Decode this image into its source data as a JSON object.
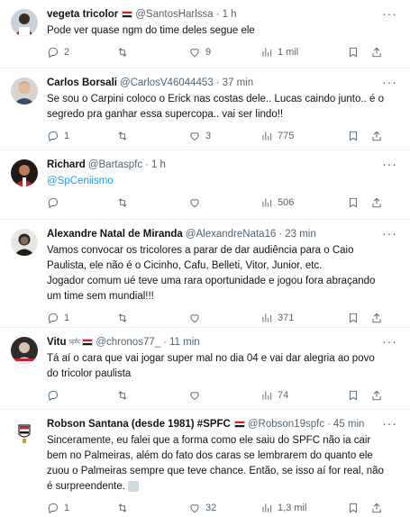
{
  "tweets": [
    {
      "name": "vegeta tricolor",
      "handle": "@SantosHarlssa",
      "time": "1 h",
      "text": "Pode ver quase ngm do time deles segue ele",
      "replies": "2",
      "retweets": "",
      "likes": "9",
      "views": "1 mil"
    },
    {
      "name": "Carlos Borsali",
      "handle": "@CarlosV46044453",
      "time": "37 min",
      "text": "Se sou o Carpini coloco o Erick nas costas dele..  Lucas caindo junto..  é o segredo pra ganhar essa supercopa.. vai ser lindo!!",
      "replies": "1",
      "retweets": "",
      "likes": "3",
      "views": "775"
    },
    {
      "name": "Richard",
      "handle": "@Bartaspfc",
      "time": "1 h",
      "text": "@SpCeniismo",
      "replies": "",
      "retweets": "",
      "likes": "",
      "views": "506"
    },
    {
      "name": "Alexandre Natal de Miranda",
      "handle": "@AlexandreNata16",
      "time": "23 min",
      "text": "Vamos convocar os tricolores a parar de dar audiência para o Caio Paulista,  ele não é o Cicinho,  Cafu, Belleti, Vitor, Junior, etc.\nJogador comum ué teve uma rara oportunidade e jogou fora abraçando um time sem mundial!!!",
      "replies": "1",
      "retweets": "",
      "likes": "",
      "views": "371"
    },
    {
      "name": "Vitu",
      "name_sup": "spfc",
      "handle": "@chronos77_",
      "time": "11 min",
      "text": "Tá aí o cara que vai jogar super mal no dia 04 e vai dar alegria ao povo do tricolor paulista",
      "replies": "",
      "retweets": "",
      "likes": "",
      "views": "74"
    },
    {
      "name": "Robson Santana (desde 1981) #SPFC",
      "handle": "@Robson19spfc",
      "time": "45 min",
      "text": "Sinceramente, eu falei que a forma como ele saiu do SPFC não ia cair bem no Palmeiras, além do fato dos caras se lembrarem do quanto ele zuou o Palmeiras sempre que teve chance. Então, se isso aí for real, não é surpreendente.",
      "replies": "1",
      "retweets": "",
      "likes": "32",
      "views": "1,3 mil"
    }
  ],
  "icons": {
    "reply": "reply-icon",
    "retweet": "retweet-icon",
    "like": "heart-icon",
    "views": "views-icon",
    "bookmark": "bookmark-icon",
    "share": "share-icon",
    "more": "more-icon"
  },
  "colors": {
    "text": "#0f1419",
    "secondary": "#536471",
    "link": "#1d9bf0",
    "divider": "#eff3f4"
  }
}
